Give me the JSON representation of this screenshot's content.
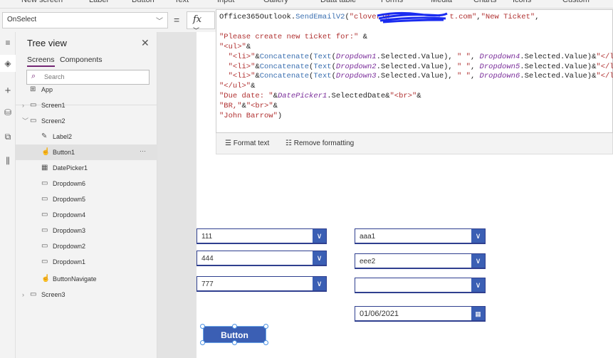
{
  "toolbar": {
    "items": [
      "New screen",
      "Label",
      "Button",
      "Text",
      "Input",
      "Gallery",
      "Data table",
      "Forms",
      "Media",
      "Charts",
      "Icons",
      "Custom"
    ]
  },
  "formula_bar": {
    "property": "OnSelect",
    "equals": "=",
    "fx": "fx"
  },
  "editor": {
    "lines": [
      [
        [
          "Office365Outlook.",
          "d"
        ],
        [
          "SendEmailV2",
          "f"
        ],
        [
          "(",
          "d"
        ],
        [
          "\"clover1@",
          "s"
        ],
        [
          "",
          "s"
        ],
        [
          "t.com\"",
          "s"
        ],
        [
          ",",
          "d"
        ],
        [
          "\"New Ticket\"",
          "s"
        ],
        [
          ",",
          "d"
        ]
      ],
      [],
      [
        [
          "\"Please create new ticket for:\"",
          "s"
        ],
        [
          " &",
          "d"
        ]
      ],
      [
        [
          "\"<ul>\"",
          "s"
        ],
        [
          "&",
          "d"
        ]
      ],
      [
        [
          "  \"<li>\"",
          "s"
        ],
        [
          "&",
          "d"
        ],
        [
          "Concatenate",
          "f"
        ],
        [
          "(",
          "d"
        ],
        [
          "Text",
          "f"
        ],
        [
          "(",
          "d"
        ],
        [
          "Dropdown1",
          "v"
        ],
        [
          ".Selected.Value), ",
          "d"
        ],
        [
          "\" \"",
          "s"
        ],
        [
          ", ",
          "d"
        ],
        [
          "Dropdown4",
          "v"
        ],
        [
          ".Selected.Value)&",
          "d"
        ],
        [
          "\"</li>\"",
          "s"
        ],
        [
          "&",
          "d"
        ]
      ],
      [
        [
          "  \"<li>\"",
          "s"
        ],
        [
          "&",
          "d"
        ],
        [
          "Concatenate",
          "f"
        ],
        [
          "(",
          "d"
        ],
        [
          "Text",
          "f"
        ],
        [
          "(",
          "d"
        ],
        [
          "Dropdown2",
          "v"
        ],
        [
          ".Selected.Value), ",
          "d"
        ],
        [
          "\" \"",
          "s"
        ],
        [
          ", ",
          "d"
        ],
        [
          "Dropdown5",
          "v"
        ],
        [
          ".Selected.Value)&",
          "d"
        ],
        [
          "\"</li>\"",
          "s"
        ],
        [
          "&",
          "d"
        ]
      ],
      [
        [
          "  \"<li>\"",
          "s"
        ],
        [
          "&",
          "d"
        ],
        [
          "Concatenate",
          "f"
        ],
        [
          "(",
          "d"
        ],
        [
          "Text",
          "f"
        ],
        [
          "(",
          "d"
        ],
        [
          "Dropdown3",
          "v"
        ],
        [
          ".Selected.Value), ",
          "d"
        ],
        [
          "\" \"",
          "s"
        ],
        [
          ", ",
          "d"
        ],
        [
          "Dropdown6",
          "v"
        ],
        [
          ".Selected.Value)&",
          "d"
        ],
        [
          "\"</li>\"",
          "s"
        ],
        [
          "&",
          "d"
        ]
      ],
      [
        [
          "\"</ul>\"",
          "s"
        ],
        [
          "&",
          "d"
        ]
      ],
      [
        [
          "\"Due date: \"",
          "s"
        ],
        [
          "&",
          "d"
        ],
        [
          "DatePicker1",
          "v"
        ],
        [
          ".SelectedDate&",
          "d"
        ],
        [
          "\"<br>\"",
          "s"
        ],
        [
          "&",
          "d"
        ]
      ],
      [
        [
          "\"BR,\"",
          "s"
        ],
        [
          "&",
          "d"
        ],
        [
          "\"<br>\"",
          "s"
        ],
        [
          "&",
          "d"
        ]
      ],
      [
        [
          "\"John Barrow\"",
          "s"
        ],
        [
          ")",
          "d"
        ]
      ]
    ]
  },
  "format_bar": {
    "format_text": "Format text",
    "remove_formatting": "Remove formatting"
  },
  "tree": {
    "title": "Tree view",
    "tabs": [
      "Screens",
      "Components"
    ],
    "search_placeholder": "Search",
    "nodes": [
      {
        "label": "App",
        "icon": "app-icon",
        "level": 0
      },
      {
        "label": "Screen1",
        "icon": "screen-icon",
        "level": 0,
        "expanded": false
      },
      {
        "label": "Screen2",
        "icon": "screen-icon",
        "level": 0,
        "expanded": true
      },
      {
        "label": "Label2",
        "icon": "label-icon",
        "level": 1
      },
      {
        "label": "Button1",
        "icon": "button-icon",
        "level": 1,
        "selected": true
      },
      {
        "label": "DatePicker1",
        "icon": "datepicker-icon",
        "level": 1
      },
      {
        "label": "Dropdown6",
        "icon": "dropdown-icon",
        "level": 1
      },
      {
        "label": "Dropdown5",
        "icon": "dropdown-icon",
        "level": 1
      },
      {
        "label": "Dropdown4",
        "icon": "dropdown-icon",
        "level": 1
      },
      {
        "label": "Dropdown3",
        "icon": "dropdown-icon",
        "level": 1
      },
      {
        "label": "Dropdown2",
        "icon": "dropdown-icon",
        "level": 1
      },
      {
        "label": "Dropdown1",
        "icon": "dropdown-icon",
        "level": 1
      },
      {
        "label": "ButtonNavigate",
        "icon": "button-icon",
        "level": 1
      },
      {
        "label": "Screen3",
        "icon": "screen-icon",
        "level": 0,
        "expanded": false
      }
    ]
  },
  "canvas": {
    "dropdown1": "111",
    "dropdown2": "444",
    "dropdown3": "777",
    "dropdown4": "aaa1",
    "dropdown5": "eee2",
    "dropdown6": "",
    "datepicker": "01/06/2021",
    "button": "Button"
  },
  "colors": {
    "accent": "#3b5fb4",
    "purple": "#742774"
  }
}
